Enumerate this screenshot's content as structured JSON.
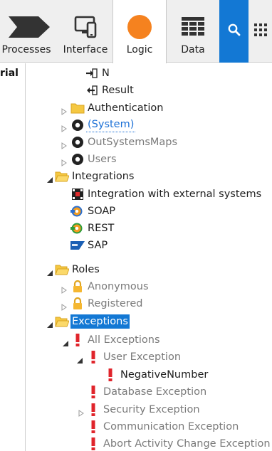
{
  "toolbar": {
    "tabs": [
      {
        "label": "Processes",
        "icon": "processes-chevron-icon"
      },
      {
        "label": "Interface",
        "icon": "interface-devices-icon"
      },
      {
        "label": "Logic",
        "icon": "logic-orange-circle-icon",
        "selected": true
      },
      {
        "label": "Data",
        "icon": "data-grid-icon"
      }
    ],
    "search_icon": "search-icon",
    "more_icon": "grid-more-icon",
    "accent_color": "#1378d4",
    "logic_color": "#f5821f"
  },
  "left_panel": {
    "label": "rial"
  },
  "tree": [
    {
      "label": "N",
      "icon": "input-parameter-icon"
    },
    {
      "label": "Result",
      "icon": "output-parameter-icon"
    },
    {
      "label": "Authentication",
      "icon": "folder-closed-icon"
    },
    {
      "label": "(System)",
      "icon": "module-reference-icon"
    },
    {
      "label": "OutSystemsMaps",
      "icon": "module-reference-icon"
    },
    {
      "label": "Users",
      "icon": "module-reference-icon"
    },
    {
      "label": "Integrations",
      "icon": "folder-open-icon"
    },
    {
      "label": "Integration with external systems",
      "icon": "integration-icon"
    },
    {
      "label": "SOAP",
      "icon": "soap-icon"
    },
    {
      "label": "REST",
      "icon": "rest-icon"
    },
    {
      "label": "SAP",
      "icon": "sap-icon"
    },
    {
      "label": "Roles",
      "icon": "folder-open-icon"
    },
    {
      "label": "Anonymous",
      "icon": "lock-icon"
    },
    {
      "label": "Registered",
      "icon": "lock-icon"
    },
    {
      "label": "Exceptions",
      "icon": "folder-open-icon"
    },
    {
      "label": "All Exceptions",
      "icon": "exception-icon"
    },
    {
      "label": "User Exception",
      "icon": "exception-icon"
    },
    {
      "label": "NegativeNumber",
      "icon": "exception-icon"
    },
    {
      "label": "Database Exception",
      "icon": "exception-icon"
    },
    {
      "label": "Security Exception",
      "icon": "exception-icon"
    },
    {
      "label": "Communication Exception",
      "icon": "exception-icon"
    },
    {
      "label": "Abort Activity Change Exception",
      "icon": "exception-icon"
    }
  ]
}
